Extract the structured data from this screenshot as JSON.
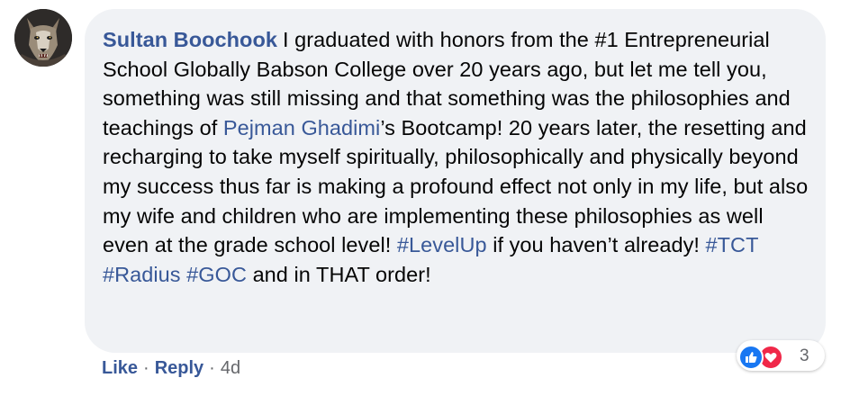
{
  "comment": {
    "author": "Sultan Boochook",
    "text_segments": [
      "I graduated with honors from the #1 Entrepreneurial School Globally Babson College over 20 years ago, but let me tell you, something was still missing and that something was the philosophies and teachings of ",
      "Pejman Ghadimi",
      "’s Bootcamp! 20 years later, the resetting and recharging to take myself spiritually, philosophically and physically beyond my success thus far is making a profound effect not only in my life, but also my wife and children who are implementing these philosophies as well even at the grade school level! ",
      "#LevelUp",
      " if you haven’t already! ",
      "#TCT",
      " ",
      "#Radius",
      " ",
      "#GOC",
      " and in THAT order!"
    ],
    "reactions": {
      "icons": [
        "like-icon",
        "love-icon"
      ],
      "count": "3"
    },
    "actions": {
      "like": "Like",
      "separator": "·",
      "reply": "Reply",
      "time": "4d"
    }
  },
  "colors": {
    "bubble": "#f0f2f5",
    "link": "#385898",
    "text": "#050505",
    "meta": "#65676b",
    "like": "#1877f2",
    "love": "#f02849"
  }
}
